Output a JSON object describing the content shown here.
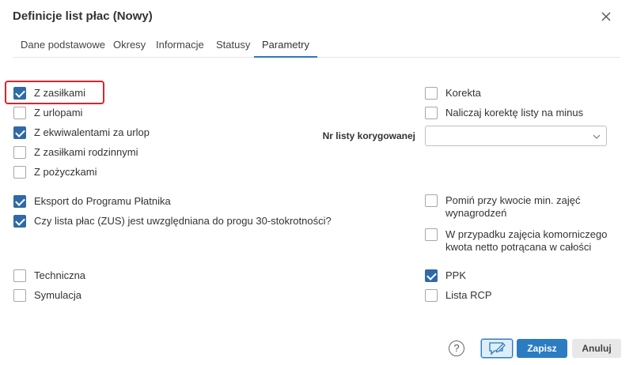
{
  "dialog": {
    "title": "Definicje list płac (Nowy)"
  },
  "tabs": [
    {
      "label": "Dane podstawowe",
      "active": false
    },
    {
      "label": "Okresy",
      "active": false
    },
    {
      "label": "Informacje",
      "active": false
    },
    {
      "label": "Statusy",
      "active": false
    },
    {
      "label": "Parametry",
      "active": true
    }
  ],
  "left_options": [
    {
      "label": "Z zasiłkami",
      "checked": true
    },
    {
      "label": "Z urlopami",
      "checked": false
    },
    {
      "label": "Z ekwiwalentami za urlop",
      "checked": true
    },
    {
      "label": "Z zasiłkami rodzinnymi",
      "checked": false
    },
    {
      "label": "Z pożyczkami",
      "checked": false
    },
    {
      "label": "Eksport do Programu Płatnika",
      "checked": true
    },
    {
      "label": "Czy lista płac (ZUS) jest uwzględniana do progu 30-stokrotności?",
      "checked": true
    },
    {
      "label": "Techniczna",
      "checked": false
    },
    {
      "label": "Symulacja",
      "checked": false
    }
  ],
  "right_options": [
    {
      "label": "Korekta",
      "checked": false
    },
    {
      "label": "Naliczaj korektę listy na minus",
      "checked": false
    },
    {
      "label_line1": "Pomiń przy kwocie min. zajęć",
      "label_line2": "wynagrodzeń",
      "checked": false
    },
    {
      "label_line1": "W przypadku zajęcia komorniczego",
      "label_line2": "kwota netto potrącana w całości",
      "checked": false
    },
    {
      "label": "PPK",
      "checked": true
    },
    {
      "label": "Lista RCP",
      "checked": false
    }
  ],
  "correction_list": {
    "label": "Nr listy korygowanej",
    "value": ""
  },
  "footer": {
    "help_label": "?",
    "save_label": "Zapisz",
    "cancel_label": "Anuluj"
  },
  "colors": {
    "accent": "#2b7cc1",
    "checkbox_checked": "#2f6aa6",
    "highlight": "#d9252c"
  }
}
